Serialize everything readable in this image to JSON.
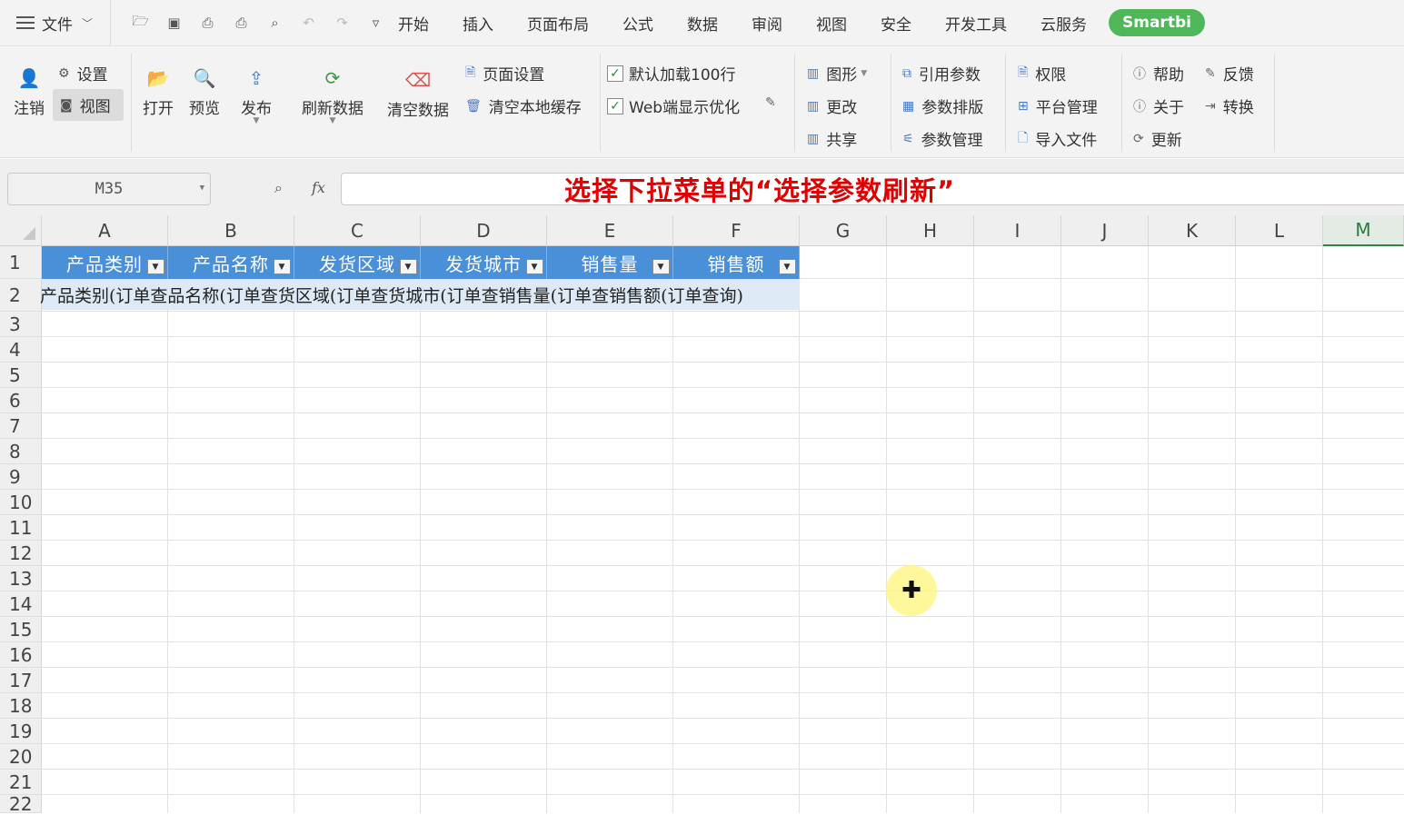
{
  "menubar": {
    "file_label": "文件",
    "tabs": [
      "开始",
      "插入",
      "页面布局",
      "公式",
      "数据",
      "审阅",
      "视图",
      "安全",
      "开发工具",
      "云服务"
    ],
    "smartbi_label": "Smartbi"
  },
  "ribbon": {
    "logout": "注销",
    "settings": "设置",
    "view": "视图",
    "open": "打开",
    "preview": "预览",
    "publish": "发布",
    "refresh_data": "刷新数据",
    "clear_data": "清空数据",
    "page_setup": "页面设置",
    "clear_cache": "清空本地缓存",
    "default_load": "默认加载100行",
    "web_optimize": "Web端显示优化",
    "chart": "图形",
    "change": "更改",
    "share": "共享",
    "ref_params": "引用参数",
    "param_layout": "参数排版",
    "param_manage": "参数管理",
    "permission": "权限",
    "platform_manage": "平台管理",
    "import_file": "导入文件",
    "help": "帮助",
    "feedback": "反馈",
    "about": "关于",
    "convert": "转换",
    "update": "更新"
  },
  "formula_bar": {
    "name_box": "M35",
    "fx": "fx",
    "content": "选择下拉菜单的“选择参数刷新”"
  },
  "sheet": {
    "columns": [
      "A",
      "B",
      "C",
      "D",
      "E",
      "F",
      "G",
      "H",
      "I",
      "J",
      "K",
      "L",
      "M"
    ],
    "rows": [
      "1",
      "2",
      "3",
      "4",
      "5",
      "6",
      "7",
      "8",
      "9",
      "10",
      "11",
      "12",
      "13",
      "14",
      "15",
      "16",
      "17",
      "18",
      "19",
      "20",
      "21",
      "22"
    ],
    "header_cells": [
      "产品类别",
      "产品名称",
      "发货区域",
      "发货城市",
      "销售量",
      "销售额"
    ],
    "row2_text": "产品类别(订单查品名称(订单查货区域(订单查货城市(订单查销售量(订单查销售额(订单查询)",
    "header_color": "#4a90d9",
    "selected_column": "M"
  }
}
